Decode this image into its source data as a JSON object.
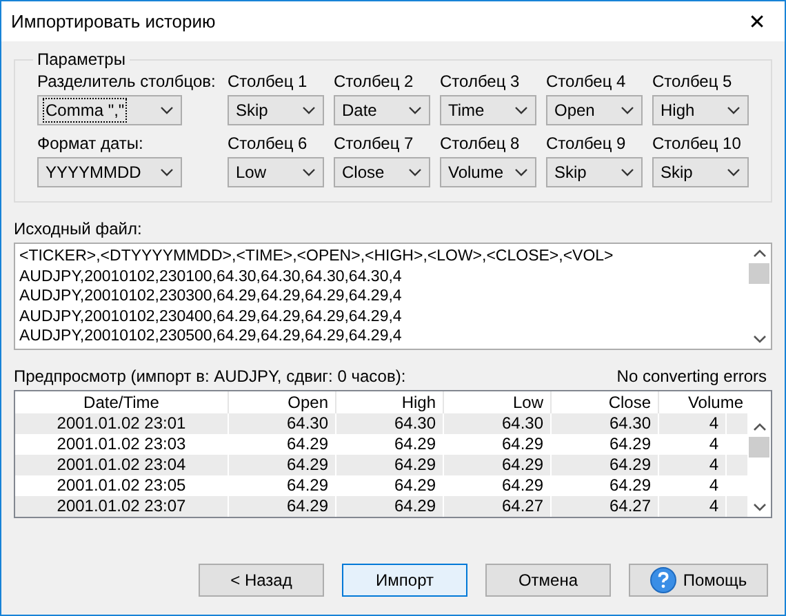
{
  "window": {
    "title": "Импортировать историю",
    "close": "✕"
  },
  "parameters": {
    "title": "Параметры",
    "separator": {
      "label": "Разделитель столбцов:",
      "value": "Comma \",\"",
      "focused": true
    },
    "date_format": {
      "label": "Формат даты:",
      "value": "YYYYMMDD",
      "focused": false
    },
    "columns": [
      {
        "label": "Столбец 1",
        "value": "Skip"
      },
      {
        "label": "Столбец 2",
        "value": "Date"
      },
      {
        "label": "Столбец 3",
        "value": "Time"
      },
      {
        "label": "Столбец 4",
        "value": "Open"
      },
      {
        "label": "Столбец 5",
        "value": "High"
      },
      {
        "label": "Столбец 6",
        "value": "Low"
      },
      {
        "label": "Столбец 7",
        "value": "Close"
      },
      {
        "label": "Столбец 8",
        "value": "Volume"
      },
      {
        "label": "Столбец 9",
        "value": "Skip"
      },
      {
        "label": "Столбец 10",
        "value": "Skip"
      }
    ]
  },
  "source": {
    "label": "Исходный файл:",
    "lines": [
      "<TICKER>,<DTYYYYMMDD>,<TIME>,<OPEN>,<HIGH>,<LOW>,<CLOSE>,<VOL>",
      "AUDJPY,20010102,230100,64.30,64.30,64.30,64.30,4",
      "AUDJPY,20010102,230300,64.29,64.29,64.29,64.29,4",
      "AUDJPY,20010102,230400,64.29,64.29,64.29,64.29,4",
      "AUDJPY,20010102,230500,64.29,64.29,64.29,64.29,4"
    ]
  },
  "preview": {
    "label": "Предпросмотр (импорт в: AUDJPY, сдвиг: 0 часов):",
    "status": "No converting errors",
    "columns": [
      "Date/Time",
      "Open",
      "High",
      "Low",
      "Close",
      "Volume"
    ],
    "rows": [
      [
        "2001.01.02 23:01",
        "64.30",
        "64.30",
        "64.30",
        "64.30",
        "4"
      ],
      [
        "2001.01.02 23:03",
        "64.29",
        "64.29",
        "64.29",
        "64.29",
        "4"
      ],
      [
        "2001.01.02 23:04",
        "64.29",
        "64.29",
        "64.29",
        "64.29",
        "4"
      ],
      [
        "2001.01.02 23:05",
        "64.29",
        "64.29",
        "64.29",
        "64.29",
        "4"
      ],
      [
        "2001.01.02 23:07",
        "64.29",
        "64.29",
        "64.27",
        "64.27",
        "4"
      ]
    ]
  },
  "buttons": [
    {
      "label": "< Назад",
      "default": false,
      "kind": "plain"
    },
    {
      "label": "Импорт",
      "default": true,
      "kind": "plain"
    },
    {
      "label": "Отмена",
      "default": false,
      "kind": "plain"
    },
    {
      "label": "Помощь",
      "default": false,
      "kind": "help"
    }
  ]
}
